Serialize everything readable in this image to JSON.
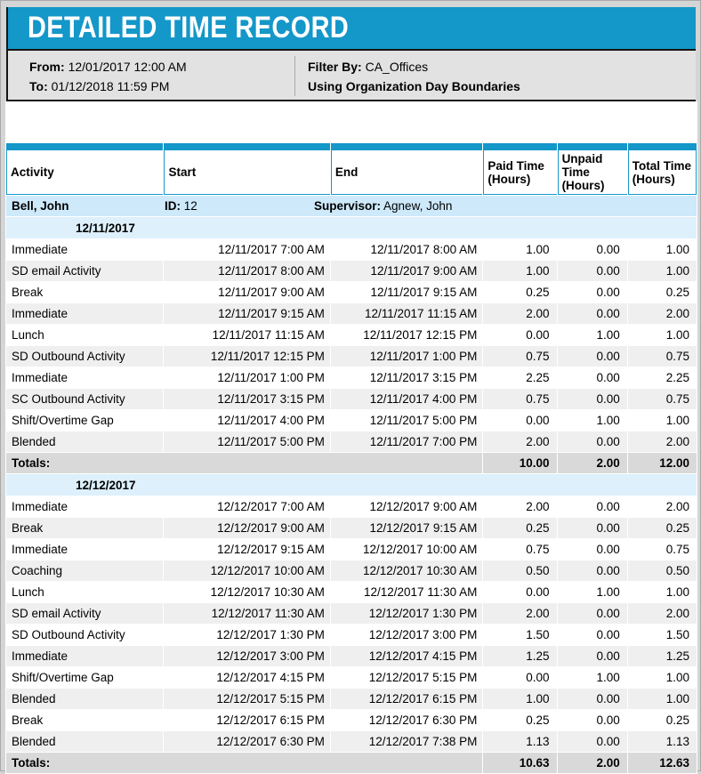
{
  "title": "DETAILED TIME RECORD",
  "filters": {
    "from_label": "From:",
    "from_value": "12/01/2017 12:00 AM",
    "to_label": "To:",
    "to_value": "01/12/2018 11:59 PM",
    "filter_by_label": "Filter By:",
    "filter_by_value": "CA_Offices",
    "boundaries_note": "Using Organization Day Boundaries"
  },
  "table": {
    "columns": [
      "Activity",
      "Start",
      "End",
      "Paid Time (Hours)",
      "Unpaid Time (Hours)",
      "Total Time (Hours)"
    ],
    "employee": {
      "name": "Bell, John",
      "id_label": "ID:",
      "id_value": "12",
      "supervisor_label": "Supervisor:",
      "supervisor_value": "Agnew, John"
    },
    "totals_label": "Totals:",
    "groups": [
      {
        "date": "12/11/2017",
        "rows": [
          [
            "Immediate",
            "12/11/2017 7:00 AM",
            "12/11/2017 8:00 AM",
            "1.00",
            "0.00",
            "1.00"
          ],
          [
            "SD email Activity",
            "12/11/2017 8:00 AM",
            "12/11/2017 9:00 AM",
            "1.00",
            "0.00",
            "1.00"
          ],
          [
            "Break",
            "12/11/2017 9:00 AM",
            "12/11/2017 9:15 AM",
            "0.25",
            "0.00",
            "0.25"
          ],
          [
            "Immediate",
            "12/11/2017 9:15 AM",
            "12/11/2017 11:15 AM",
            "2.00",
            "0.00",
            "2.00"
          ],
          [
            "Lunch",
            "12/11/2017 11:15 AM",
            "12/11/2017 12:15 PM",
            "0.00",
            "1.00",
            "1.00"
          ],
          [
            "SD Outbound Activity",
            "12/11/2017 12:15 PM",
            "12/11/2017 1:00 PM",
            "0.75",
            "0.00",
            "0.75"
          ],
          [
            "Immediate",
            "12/11/2017 1:00 PM",
            "12/11/2017 3:15 PM",
            "2.25",
            "0.00",
            "2.25"
          ],
          [
            "SC Outbound Activity",
            "12/11/2017 3:15 PM",
            "12/11/2017 4:00 PM",
            "0.75",
            "0.00",
            "0.75"
          ],
          [
            "Shift/Overtime Gap",
            "12/11/2017 4:00 PM",
            "12/11/2017 5:00 PM",
            "0.00",
            "1.00",
            "1.00"
          ],
          [
            "Blended",
            "12/11/2017 5:00 PM",
            "12/11/2017 7:00 PM",
            "2.00",
            "0.00",
            "2.00"
          ]
        ],
        "totals": {
          "paid": "10.00",
          "unpaid": "2.00",
          "total": "12.00"
        }
      },
      {
        "date": "12/12/2017",
        "rows": [
          [
            "Immediate",
            "12/12/2017 7:00 AM",
            "12/12/2017 9:00 AM",
            "2.00",
            "0.00",
            "2.00"
          ],
          [
            "Break",
            "12/12/2017 9:00 AM",
            "12/12/2017 9:15 AM",
            "0.25",
            "0.00",
            "0.25"
          ],
          [
            "Immediate",
            "12/12/2017 9:15 AM",
            "12/12/2017 10:00 AM",
            "0.75",
            "0.00",
            "0.75"
          ],
          [
            "Coaching",
            "12/12/2017 10:00 AM",
            "12/12/2017 10:30 AM",
            "0.50",
            "0.00",
            "0.50"
          ],
          [
            "Lunch",
            "12/12/2017 10:30 AM",
            "12/12/2017 11:30 AM",
            "0.00",
            "1.00",
            "1.00"
          ],
          [
            "SD email Activity",
            "12/12/2017 11:30 AM",
            "12/12/2017 1:30 PM",
            "2.00",
            "0.00",
            "2.00"
          ],
          [
            "SD Outbound Activity",
            "12/12/2017 1:30 PM",
            "12/12/2017 3:00 PM",
            "1.50",
            "0.00",
            "1.50"
          ],
          [
            "Immediate",
            "12/12/2017 3:00 PM",
            "12/12/2017 4:15 PM",
            "1.25",
            "0.00",
            "1.25"
          ],
          [
            "Shift/Overtime Gap",
            "12/12/2017 4:15 PM",
            "12/12/2017 5:15 PM",
            "0.00",
            "1.00",
            "1.00"
          ],
          [
            "Blended",
            "12/12/2017 5:15 PM",
            "12/12/2017 6:15 PM",
            "1.00",
            "0.00",
            "1.00"
          ],
          [
            "Break",
            "12/12/2017 6:15 PM",
            "12/12/2017 6:30 PM",
            "0.25",
            "0.00",
            "0.25"
          ],
          [
            "Blended",
            "12/12/2017 6:30 PM",
            "12/12/2017 7:38 PM",
            "1.13",
            "0.00",
            "1.13"
          ]
        ],
        "totals": {
          "paid": "10.63",
          "unpaid": "2.00",
          "total": "12.63"
        }
      }
    ]
  },
  "colors": {
    "accent_blue": "#1497c9",
    "employee_row_bg": "#cde9fa",
    "date_row_bg": "#ddf0fc",
    "alt_row_bg": "#efefef",
    "totals_row_bg": "#d9d9d9",
    "info_box_bg": "#e2e2e2",
    "page_bg": "#d5d5d5",
    "border_black": "#151515"
  }
}
